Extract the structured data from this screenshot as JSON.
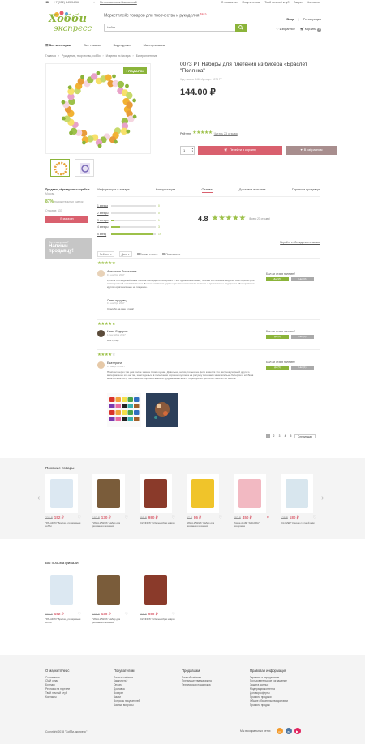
{
  "topbar": {
    "phone": "+7 (952) 243 34 56",
    "city": "Петропавловск-Камчатский",
    "links": [
      "О компании",
      "Покупателям",
      "Твой личный клуб",
      "Акции",
      "Контакты"
    ]
  },
  "header": {
    "logo_top": "Хобби",
    "logo_bottom": "экспресс",
    "slogan": "Маркетплейс товаров для творчества и рукоделия",
    "beta": "БЕТА",
    "search_placeholder": "Найти",
    "login": "Вход",
    "register": "Регистрация",
    "favorites": "Избранное",
    "cart": "Корзина",
    "cart_count": "0"
  },
  "nav": [
    "Все категории",
    "Все товары",
    "Видеоуроки",
    "Мастер-классы"
  ],
  "breadcrumb": [
    "Главная",
    "Рукоделие, творчество, хобби",
    "Изделия из бисера",
    "Бисероплетение"
  ],
  "product": {
    "title": "0073 РТ Наборы для плетения из бисера «Браслет \"Полянка\"",
    "sku": "Код товара: 8465   Артикул: 0073 РТ",
    "price": "144.00 ₽",
    "gift": "+ ПОДАРОК",
    "rating_label": "Рейтинг",
    "reviews_link": "Читать 23 отзыва",
    "qty": "1",
    "cart_btn": "Перейти в корзину",
    "fav_btn": "В избранном"
  },
  "seller": {
    "name": "Продавец «Креатушки и скрабы»",
    "city": "Москва",
    "pct": "87%",
    "pct_label": "положительных оценок",
    "reviews": "Отзывов: 137",
    "btn": "В магазин"
  },
  "ask": {
    "line1": "Есть вопросы?",
    "line2": "Напиши продавцу!"
  },
  "tabs": [
    "Информация о товаре",
    "Консультации",
    "Отзывы",
    "Доставка и оплата",
    "Гарантии продавца"
  ],
  "ratings": {
    "dist": [
      {
        "label": "1 звезда",
        "count": "0",
        "frac": 0.0
      },
      {
        "label": "2 звезды",
        "count": "0",
        "frac": 0.0
      },
      {
        "label": "3 звезды",
        "count": "1",
        "frac": 0.08
      },
      {
        "label": "4 звезды",
        "count": "3",
        "frac": 0.2
      },
      {
        "label": "5 звезд",
        "count": "19",
        "frac": 0.95
      }
    ],
    "avg": "4.8",
    "of": "(Всего 23 отзыва)",
    "all_link": "Перейти к обсуждению отзывов"
  },
  "filters": {
    "sort": "Рейтинг",
    "date": "Дата",
    "with_photo": "Только с фото",
    "by_helpful": "Полезность"
  },
  "reviews": [
    {
      "name": "Антонина Лисичкина",
      "date": "15 ноября 2017",
      "text": "Купила по сведений изюм бисера последнего бисерного – это функциональные, теплые и стильные модели. Они хорошо для повседневной носки вязанием. В какой комплект удобен грелка, начинается отлично и оригинально подарочки. Мне нравятся кругом оригинальные на пощение.",
      "reply_title": "Ответ продавца",
      "reply_date": "15 ноября 2017",
      "reply_text": "Спасибо за ваш отзыв!",
      "help": "Был ли отзыв полезен?",
      "yes": "Да (15)",
      "no": "Нет (3)"
    },
    {
      "name": "Иван Сидоров",
      "date": "1 сентября 2017",
      "text": "Все супер",
      "help": "Был ли отзыв полезен?",
      "yes": "Да (8)",
      "no": "Нет (0)"
    },
    {
      "name": "Екатерина",
      "date": "12 августа 2017",
      "text": "Прислал через три дня после заказа прямо кухню. Довольна, нитки, только на фото кажется что рисунок узорный другого материала но это не так, за эти деньги в посылании хорошая куплена на рисунку мишками замечательно бисером и клубков много очень Хочу 42 плашечки хорошая вышить буду вышивать её и Хорошую но фотки не блестят но нашла.",
      "help": "Был ли отзыв полезен?",
      "yes": "Да (5)",
      "no": "Нет (1)"
    }
  ],
  "pager": [
    "1",
    "2",
    "3",
    "4",
    "5"
  ],
  "pager_next": "Следующая",
  "similar": {
    "title": "Похожие товары",
    "items": [
      {
        "old": "232 ₽",
        "new": "152 ₽",
        "name": "\"PALADZO\" Брелок для вкрамы и хобби",
        "fav": false
      },
      {
        "old": "182 ₽",
        "new": "130 ₽",
        "name": "\"WIZA-WWIZA\" Набор для рисования мозаикой",
        "fav": false
      },
      {
        "old": "395 ₽",
        "new": "980 ₽",
        "name": "\"CZINNOS\" Гобелен образ коврик",
        "fav": false
      },
      {
        "old": "97 ₽",
        "new": "86 ₽",
        "name": "\"WIZA-WWIZA\" Набор для рисования мозаикой",
        "fav": false
      },
      {
        "old": "482 ₽",
        "new": "450 ₽",
        "name": "Пряжа ALIZE \"ANGORA\" мохеровая",
        "fav": true
      },
      {
        "old": "128 ₽",
        "new": "180 ₽",
        "name": "\"CLOVER\" Крючок с ручкой 2мм",
        "fav": false
      }
    ]
  },
  "viewed": {
    "title": "Вы просматривали",
    "items": [
      {
        "old": "232 ₽",
        "new": "152 ₽",
        "name": "\"PALADZO\" Брелок для вкрамы и хобби",
        "fav": false
      },
      {
        "old": "182 ₽",
        "new": "130 ₽",
        "name": "\"WIZA-WWIZA\" Набор для рисования мозаикой",
        "fav": false
      },
      {
        "old": "395 ₽",
        "new": "980 ₽",
        "name": "\"CZINNOS\" Гобелен образ коврик",
        "fav": false
      }
    ]
  },
  "footer": {
    "cols": [
      {
        "h": "О маркетплейс",
        "items": [
          "О компании",
          "СМИ о нас",
          "Бренды",
          "Реклама на портале",
          "Твой личный клуб",
          "Контакты"
        ]
      },
      {
        "h": "Покупателям",
        "items": [
          "Личный кабинет",
          "Как купить?",
          "Оплата",
          "Доставка",
          "Возврат",
          "Акции",
          "Вопросы покупателей",
          "Частые вопросы"
        ]
      },
      {
        "h": "Продавцам",
        "items": [
          "Личный кабинет",
          "Преимущества магазина",
          "Техническая поддержка"
        ]
      },
      {
        "h": "Правовая информация",
        "items": [
          "Термины и определения",
          "Пользовательское соглашение",
          "Защита данных",
          "Модерация контента",
          "Договор оферты",
          "Правила продажи",
          "Общие обязательства доставки",
          "Правила продаж"
        ]
      }
    ],
    "copyright": "Copyright 2018 \"Хобби-экспресс\"",
    "social_label": "Мы в социальных сетях"
  },
  "colors": {
    "accent": "#8bb43a",
    "pink": "#d9606e"
  }
}
